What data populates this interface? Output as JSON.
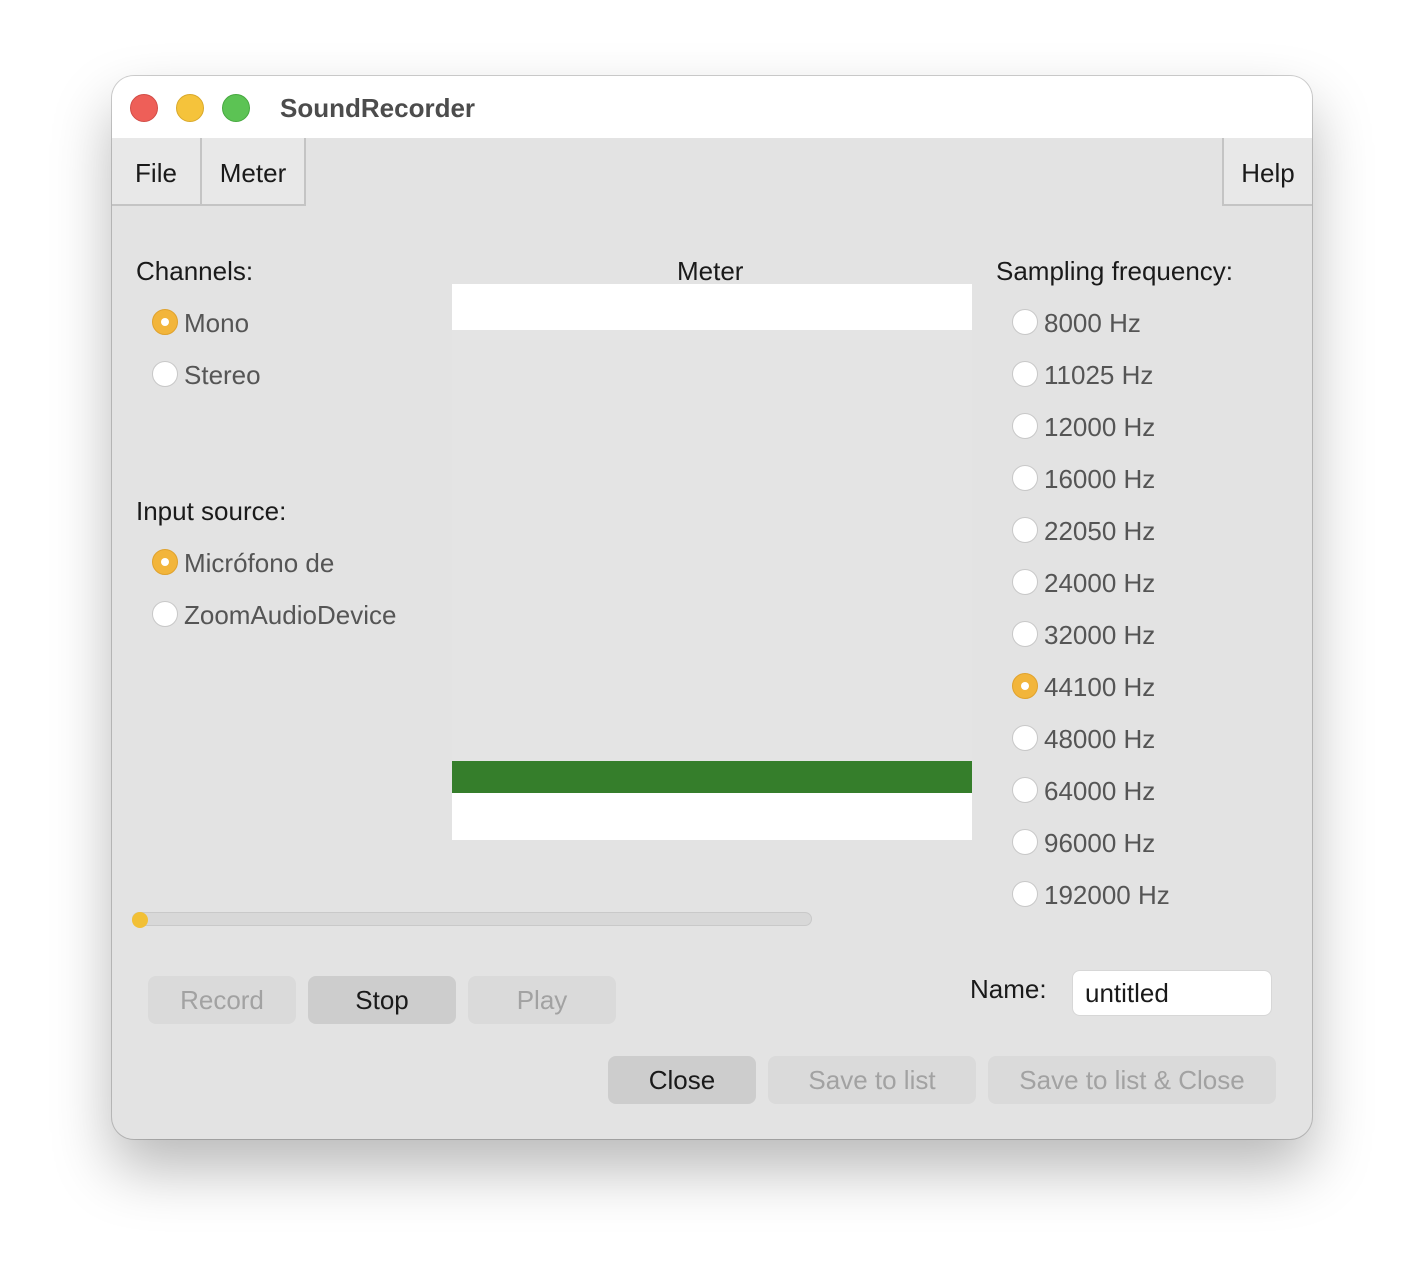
{
  "window": {
    "title": "SoundRecorder"
  },
  "menubar": {
    "file": "File",
    "meter": "Meter",
    "help": "Help"
  },
  "channels": {
    "label": "Channels:",
    "options": [
      "Mono",
      "Stereo"
    ],
    "selected": "Mono"
  },
  "input_source": {
    "label": "Input source:",
    "options": [
      "Micrófono de",
      "ZoomAudioDevice"
    ],
    "selected": "Micrófono de"
  },
  "meter": {
    "label": "Meter",
    "level_color": "#357e2b"
  },
  "sampling": {
    "label": "Sampling frequency:",
    "options": [
      "8000 Hz",
      "11025 Hz",
      "12000 Hz",
      "16000 Hz",
      "22050 Hz",
      "24000 Hz",
      "32000 Hz",
      "44100 Hz",
      "48000 Hz",
      "64000 Hz",
      "96000 Hz",
      "192000 Hz"
    ],
    "selected": "44100 Hz"
  },
  "position_slider": {
    "value": 0
  },
  "controls": {
    "record": "Record",
    "stop": "Stop",
    "play": "Play"
  },
  "name": {
    "label": "Name:",
    "value": "untitled"
  },
  "footer": {
    "close": "Close",
    "save_to_list": "Save to list",
    "save_to_list_close": "Save to list & Close"
  },
  "colors": {
    "accent": "#f2b53b",
    "close_light": "#ee5f58",
    "minimize_light": "#f5c33b",
    "zoom_light": "#5cc354"
  }
}
